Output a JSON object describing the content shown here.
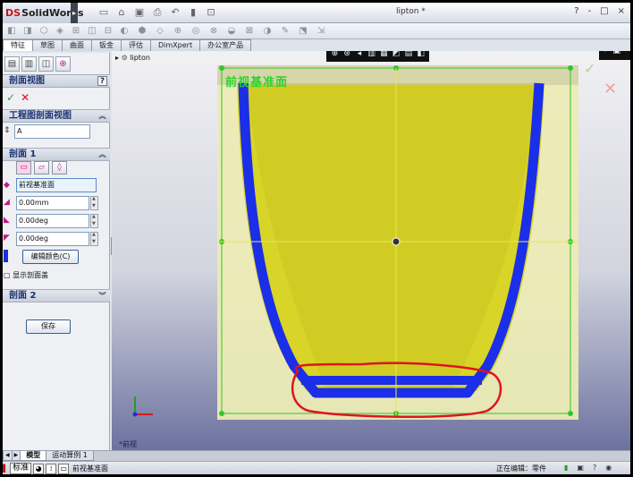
{
  "app": {
    "brand_prefix": "DS",
    "brand_name": "SolidWorks",
    "document_title": "lipton *",
    "window_buttons": [
      "?",
      "-",
      "□",
      "×"
    ]
  },
  "command_tabs": [
    "特征",
    "草图",
    "曲面",
    "钣金",
    "评估",
    "DimXpert",
    "办公室产品"
  ],
  "panel": {
    "title": "剖面视图",
    "help_symbol": "?",
    "ok_symbol": "✓",
    "cancel_symbol": "✕",
    "drawing_section": {
      "header": "工程图剖面视图",
      "name_value": "A"
    },
    "section1": {
      "header": "剖面 1",
      "plane_value": "前视基准面",
      "offset_value": "0.00mm",
      "angle1_value": "0.00deg",
      "angle2_value": "0.00deg",
      "edit_color_label": "编辑颜色(C)",
      "show_cap_label": "显示剖面盖"
    },
    "section2": {
      "header": "剖面 2"
    },
    "save_label": "保存"
  },
  "graphics": {
    "tree_root": "lipton",
    "plane_label": "前视基准面",
    "view_label": "*前视",
    "part_fill_color": "#d8d428",
    "section_color": "#1b2ee8",
    "plane_border_color": "#2ec72e",
    "annotation_color": "#e0141e"
  },
  "bottom_tabs": [
    "◀",
    "▶",
    "模型",
    "运动算例 1"
  ],
  "status": {
    "standard_label": "标准",
    "hint_text": "前视基准面",
    "edit_state": "正在编辑：零件"
  }
}
